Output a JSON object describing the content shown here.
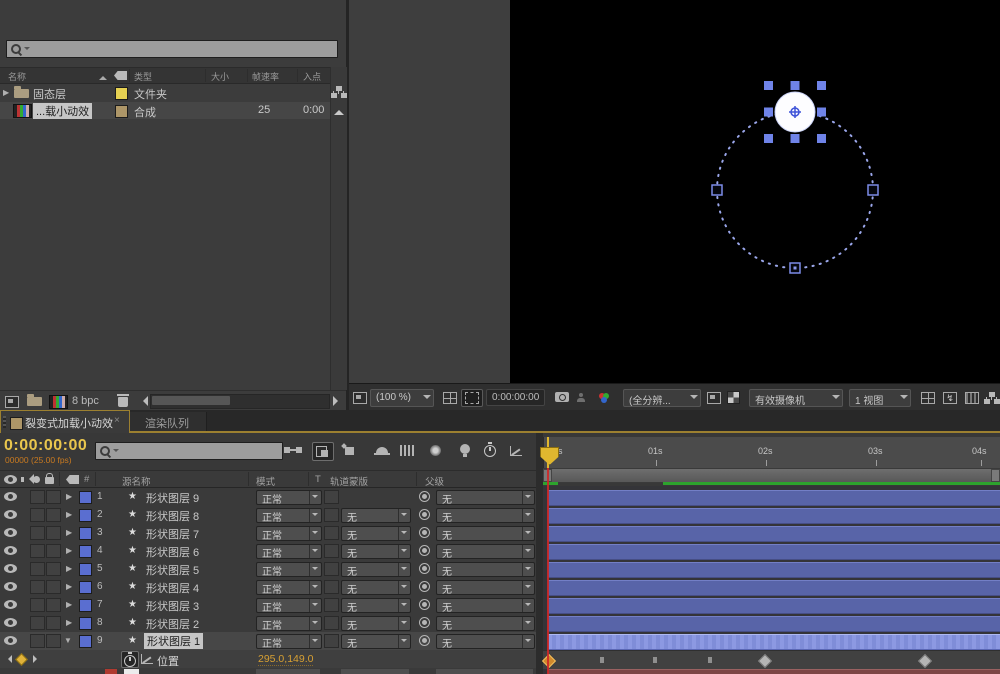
{
  "colors": {
    "timecode_orange": "#e9c64d",
    "fps_orange": "#c97a20",
    "layer_bar_blue": "#5864a8",
    "selected_bar_blue": "#8c99e2",
    "cache_green": "#2da32d",
    "keyframe_orange": "#d0892c",
    "folder_swatch_yellow": "#e6d152",
    "comp_swatch_tan": "#ad9668",
    "layer_swatch_blue": "#5a6ed0",
    "playhead_yellow": "#e0b72f",
    "playhead_line_red": "#cd2828"
  },
  "icons": {
    "search": "magnifier",
    "folder": "folder shape",
    "composition": "film thumbnail",
    "flowchart": "connected boxes",
    "eye": "visibility oval",
    "speaker": "audio",
    "solo": "dot",
    "lock": "padlock",
    "tag": "label tag",
    "star": "shape-layer star",
    "pick_whip": "spiral bullseye",
    "stopwatch": "animation stopwatch",
    "graph": "expression graph",
    "trash": "delete bin",
    "camera": "snapshot camera",
    "checkerboard": "transparency grid",
    "rgb": "show channels",
    "lightning": "pixel aspect correction"
  },
  "project": {
    "search_value": "",
    "cols": {
      "name": "名称",
      "type": "类型",
      "size": "大小",
      "fps": "帧速率",
      "inpoint": "入点"
    },
    "i1": {
      "name": "固态层",
      "type": "文件夹"
    },
    "i2": {
      "name": "...载小动效",
      "type": "合成",
      "fps": "25",
      "inpoint": "0:00"
    },
    "bpc": "8 bpc"
  },
  "viewer": {
    "zoom": "(100 %)",
    "tc": "0:00:00:00",
    "res": "(全分辨...",
    "cam": "有效摄像机",
    "views": "1 视图"
  },
  "tabs": {
    "t1": "裂变式加载小动效",
    "close": "×",
    "t2": "渲染队列"
  },
  "t": {
    "tc": "0:00:00:00",
    "fps": "00000 (25.00 fps)",
    "h": {
      "num": "#",
      "src": "源名称",
      "mode": "模式",
      "t": "T",
      "matte": "轨道蒙版",
      "parent": "父级"
    },
    "layers": [
      {
        "n": "1",
        "name": "形状图层 9",
        "mode": "正常",
        "parent": "无"
      },
      {
        "n": "2",
        "name": "形状图层 8",
        "mode": "正常",
        "matte": "无",
        "parent": "无"
      },
      {
        "n": "3",
        "name": "形状图层 7",
        "mode": "正常",
        "matte": "无",
        "parent": "无"
      },
      {
        "n": "4",
        "name": "形状图层 6",
        "mode": "正常",
        "matte": "无",
        "parent": "无"
      },
      {
        "n": "5",
        "name": "形状图层 5",
        "mode": "正常",
        "matte": "无",
        "parent": "无"
      },
      {
        "n": "6",
        "name": "形状图层 4",
        "mode": "正常",
        "matte": "无",
        "parent": "无"
      },
      {
        "n": "7",
        "name": "形状图层 3",
        "mode": "正常",
        "matte": "无",
        "parent": "无"
      },
      {
        "n": "8",
        "name": "形状图层 2",
        "mode": "正常",
        "matte": "无",
        "parent": "无"
      },
      {
        "n": "9",
        "name": "形状图层 1",
        "mode": "正常",
        "matte": "无",
        "parent": "无"
      }
    ],
    "prop": {
      "label": "位置",
      "value": "295.0,149.0"
    },
    "ruler": [
      "0s",
      "01s",
      "02s",
      "03s",
      "04s"
    ]
  }
}
